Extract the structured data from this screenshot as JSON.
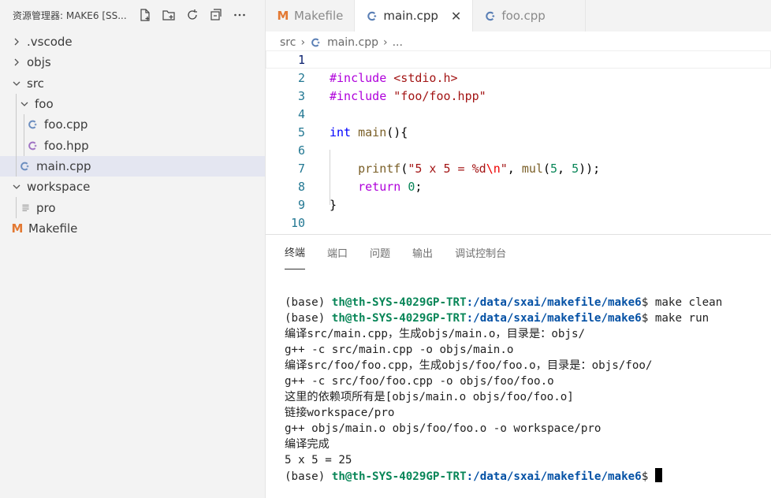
{
  "explorer": {
    "title": "资源管理器: MAKE6 [SS...",
    "tree": [
      {
        "label": ".vscode",
        "kind": "folder",
        "expanded": false,
        "depth": 0
      },
      {
        "label": "objs",
        "kind": "folder",
        "expanded": false,
        "depth": 0
      },
      {
        "label": "src",
        "kind": "folder",
        "expanded": true,
        "depth": 0
      },
      {
        "label": "foo",
        "kind": "folder",
        "expanded": true,
        "depth": 1
      },
      {
        "label": "foo.cpp",
        "kind": "cpp",
        "depth": 2
      },
      {
        "label": "foo.hpp",
        "kind": "hpp",
        "depth": 2
      },
      {
        "label": "main.cpp",
        "kind": "cpp",
        "depth": 1,
        "selected": true
      },
      {
        "label": "workspace",
        "kind": "folder",
        "expanded": true,
        "depth": 0
      },
      {
        "label": "pro",
        "kind": "file",
        "depth": 1
      },
      {
        "label": "Makefile",
        "kind": "makefile",
        "depth": 0
      }
    ]
  },
  "tabs": [
    {
      "label": "Makefile",
      "icon": "makefile-icon",
      "active": false
    },
    {
      "label": "main.cpp",
      "icon": "cpp-icon",
      "active": true,
      "close": "✕"
    },
    {
      "label": "foo.cpp",
      "icon": "cpp-icon",
      "active": false
    }
  ],
  "breadcrumb": {
    "part1": "src",
    "part2": "main.cpp",
    "part3": "..."
  },
  "editor": {
    "lines": [
      {
        "n": "1",
        "text": ""
      },
      {
        "n": "2",
        "text": "#include <stdio.h>"
      },
      {
        "n": "3",
        "text": "#include \"foo/foo.hpp\""
      },
      {
        "n": "4",
        "text": ""
      },
      {
        "n": "5",
        "text": "int main(){"
      },
      {
        "n": "6",
        "text": ""
      },
      {
        "n": "7",
        "text": "    printf(\"5 x 5 = %d\\n\", mul(5, 5));"
      },
      {
        "n": "8",
        "text": "    return 0;"
      },
      {
        "n": "9",
        "text": "}"
      },
      {
        "n": "10",
        "text": ""
      }
    ]
  },
  "panel": {
    "tabs": [
      "终端",
      "端口",
      "问题",
      "输出",
      "调试控制台"
    ],
    "active_tab": "终端"
  },
  "terminal": {
    "prompt_prefix": "(base) ",
    "user_host": "th@th-SYS-4029GP-TRT",
    "path": ":/data/sxai/makefile/make6",
    "prompt_suffix": "$ ",
    "cmd1": "make clean",
    "cmd2": "make run",
    "out": [
      "编译src/main.cpp，生成objs/main.o，目录是：objs/",
      "g++ -c src/main.cpp -o objs/main.o",
      "编译src/foo/foo.cpp，生成objs/foo/foo.o，目录是：objs/foo/",
      "g++ -c src/foo/foo.cpp -o objs/foo/foo.o",
      "这里的依赖项所有是[objs/main.o objs/foo/foo.o]",
      "链接workspace/pro",
      "g++ objs/main.o objs/foo/foo.o -o workspace/pro",
      "编译完成",
      "5 x 5 = 25"
    ]
  },
  "colors": {
    "accent": "#0b216f",
    "cpp_icon": "#6c8ebf",
    "hpp_icon": "#a074c4",
    "makefile_icon": "#e37933"
  }
}
